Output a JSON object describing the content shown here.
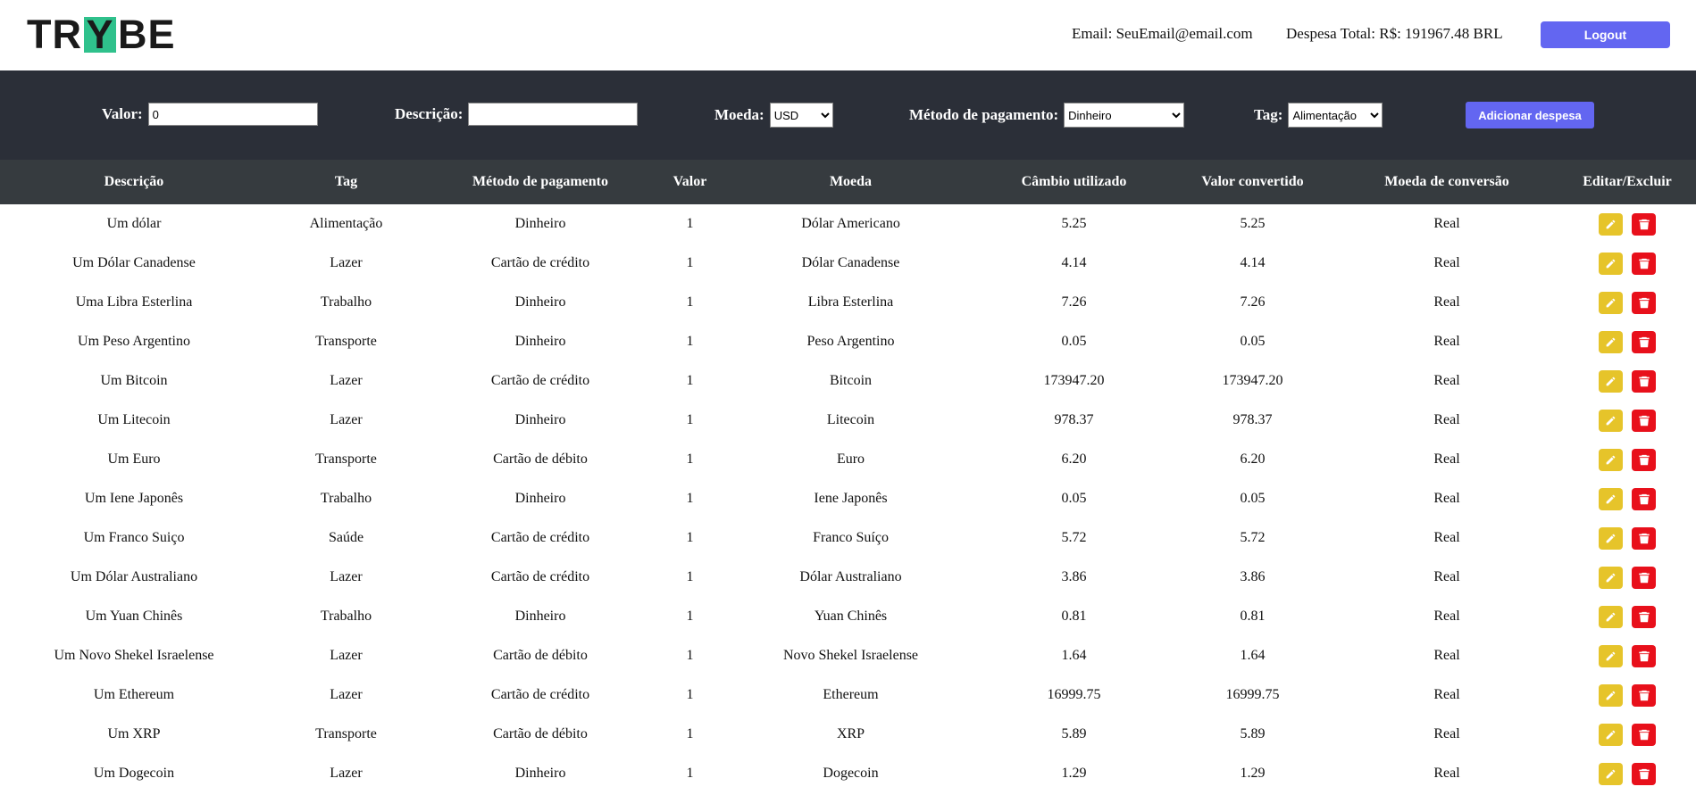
{
  "header": {
    "logo": {
      "left": "TR",
      "y": "Y",
      "right": "BE"
    },
    "email": "Email: SeuEmail@email.com",
    "total": "Despesa Total: R$: 191967.48 BRL",
    "logout_label": "Logout"
  },
  "form": {
    "valor_label": "Valor:",
    "valor_value": "0",
    "descricao_label": "Descrição:",
    "descricao_value": "",
    "moeda_label": "Moeda:",
    "moeda_value": "USD",
    "metodo_label": "Método de pagamento:",
    "metodo_value": "Dinheiro",
    "tag_label": "Tag:",
    "tag_value": "Alimentação",
    "add_label": "Adicionar despesa"
  },
  "table": {
    "columns": [
      "Descrição",
      "Tag",
      "Método de pagamento",
      "Valor",
      "Moeda",
      "Câmbio utilizado",
      "Valor convertido",
      "Moeda de conversão",
      "Editar/Excluir"
    ],
    "rows": [
      [
        "Um dólar",
        "Alimentação",
        "Dinheiro",
        "1",
        "Dólar Americano",
        "5.25",
        "5.25",
        "Real"
      ],
      [
        "Um Dólar Canadense",
        "Lazer",
        "Cartão de crédito",
        "1",
        "Dólar Canadense",
        "4.14",
        "4.14",
        "Real"
      ],
      [
        "Uma Libra Esterlina",
        "Trabalho",
        "Dinheiro",
        "1",
        "Libra Esterlina",
        "7.26",
        "7.26",
        "Real"
      ],
      [
        "Um Peso Argentino",
        "Transporte",
        "Dinheiro",
        "1",
        "Peso Argentino",
        "0.05",
        "0.05",
        "Real"
      ],
      [
        "Um Bitcoin",
        "Lazer",
        "Cartão de crédito",
        "1",
        "Bitcoin",
        "173947.20",
        "173947.20",
        "Real"
      ],
      [
        "Um Litecoin",
        "Lazer",
        "Dinheiro",
        "1",
        "Litecoin",
        "978.37",
        "978.37",
        "Real"
      ],
      [
        "Um Euro",
        "Transporte",
        "Cartão de débito",
        "1",
        "Euro",
        "6.20",
        "6.20",
        "Real"
      ],
      [
        "Um Iene Japonês",
        "Trabalho",
        "Dinheiro",
        "1",
        "Iene Japonês",
        "0.05",
        "0.05",
        "Real"
      ],
      [
        "Um Franco Suiço",
        "Saúde",
        "Cartão de crédito",
        "1",
        "Franco Suíço",
        "5.72",
        "5.72",
        "Real"
      ],
      [
        "Um Dólar Australiano",
        "Lazer",
        "Cartão de crédito",
        "1",
        "Dólar Australiano",
        "3.86",
        "3.86",
        "Real"
      ],
      [
        "Um Yuan Chinês",
        "Trabalho",
        "Dinheiro",
        "1",
        "Yuan Chinês",
        "0.81",
        "0.81",
        "Real"
      ],
      [
        "Um Novo Shekel Israelense",
        "Lazer",
        "Cartão de débito",
        "1",
        "Novo Shekel Israelense",
        "1.64",
        "1.64",
        "Real"
      ],
      [
        "Um Ethereum",
        "Lazer",
        "Cartão de crédito",
        "1",
        "Ethereum",
        "16999.75",
        "16999.75",
        "Real"
      ],
      [
        "Um XRP",
        "Transporte",
        "Cartão de débito",
        "1",
        "XRP",
        "5.89",
        "5.89",
        "Real"
      ],
      [
        "Um Dogecoin",
        "Lazer",
        "Dinheiro",
        "1",
        "Dogecoin",
        "1.29",
        "1.29",
        "Real"
      ]
    ]
  },
  "colors": {
    "accent": "#6366f1",
    "form_bar": "#2b2f38",
    "table_header": "#363b3f",
    "edit": "#e6c42a",
    "delete": "#e8101b",
    "logo_green": "#2fc18c"
  },
  "icons": {
    "edit": "pencil-icon",
    "delete": "trash-icon"
  }
}
